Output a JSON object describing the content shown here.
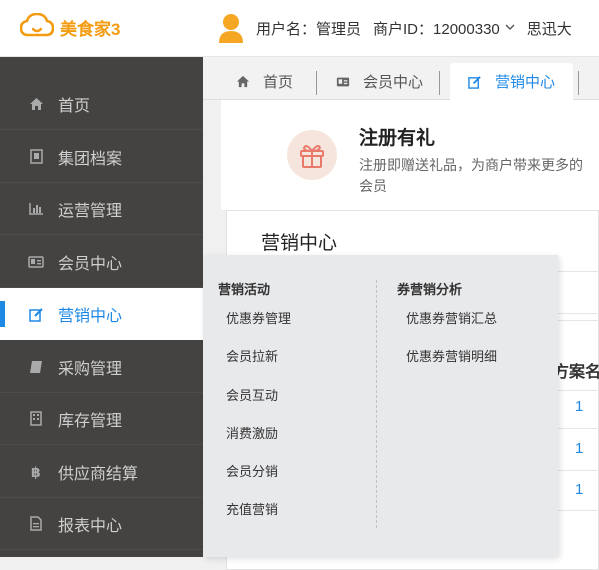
{
  "header": {
    "brand": "美食家3",
    "username_label": "用户名：管理员",
    "merchant_label": "商户ID：12000330",
    "extra": "思迅大"
  },
  "sidebar": {
    "items": [
      {
        "label": "首页",
        "icon": "home-icon"
      },
      {
        "label": "集团档案",
        "icon": "document-icon"
      },
      {
        "label": "运营管理",
        "icon": "bar-chart-icon"
      },
      {
        "label": "会员中心",
        "icon": "member-card-icon"
      },
      {
        "label": "营销中心",
        "icon": "edit-icon",
        "active": true
      },
      {
        "label": "采购管理",
        "icon": "book-icon"
      },
      {
        "label": "库存管理",
        "icon": "building-icon"
      },
      {
        "label": "供应商结算",
        "icon": "bitcoin-icon"
      },
      {
        "label": "报表中心",
        "icon": "report-icon"
      }
    ]
  },
  "tabs": [
    {
      "label": "首页",
      "icon": "home-icon"
    },
    {
      "label": "会员中心",
      "icon": "member-card-icon"
    },
    {
      "label": "营销中心",
      "icon": "edit-icon",
      "active": true
    }
  ],
  "gift": {
    "title": "注册有礼",
    "description_line1": "注册即赠送礼品，为商户带来更多的",
    "description_line2": "会员"
  },
  "panel": {
    "title": "营销中心",
    "column_header": "方案名称",
    "cells": [
      "1",
      "1",
      "1"
    ]
  },
  "dropdown": {
    "col1_heading": "营销活动",
    "col1_items": [
      "优惠券管理",
      "会员拉新",
      "会员互动",
      "消费激励",
      "会员分销",
      "充值营销"
    ],
    "col2_heading": "券营销分析",
    "col2_items": [
      "优惠券营销汇总",
      "优惠券营销明细"
    ]
  },
  "colors": {
    "accent": "#1e88e5",
    "brand": "#f39c12",
    "sidebar_bg": "#444341"
  }
}
